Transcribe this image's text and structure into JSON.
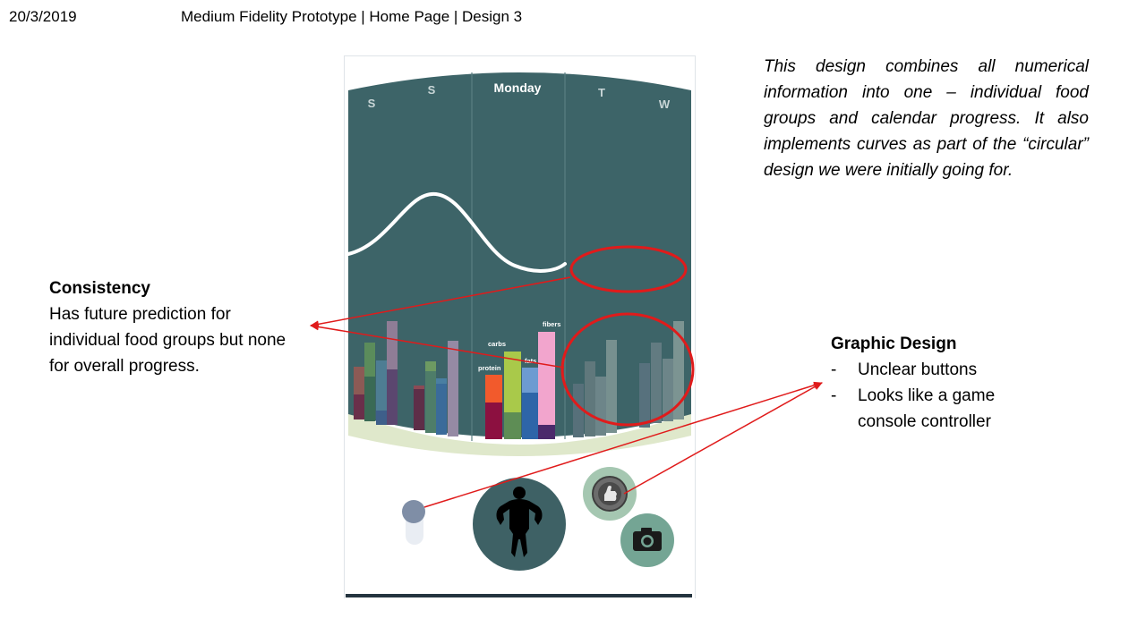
{
  "header": {
    "date": "20/3/2019",
    "title": "Medium Fidelity Prototype | Home Page | Design 3"
  },
  "phone": {
    "days": [
      "S",
      "S",
      "Monday",
      "T",
      "W"
    ],
    "bar_labels": {
      "protein": "protein",
      "carbs": "carbs",
      "fats": "fats",
      "fibers": "fibers"
    },
    "buttons": [
      "toggle",
      "body-profile",
      "achievements",
      "camera"
    ]
  },
  "description": "This design combines all numerical information into one – individual food groups and calendar progress. It also implements curves as part of the “circular” design we were initially going for.",
  "consistency": {
    "heading": "Consistency",
    "body": "Has future prediction for individual food groups but none for overall progress."
  },
  "graphic_design": {
    "heading": "Graphic Design",
    "items": [
      "Unclear buttons",
      "Looks like a game console controller"
    ]
  },
  "colors": {
    "panel": "#3d6468",
    "divider": "#5a7f82",
    "arc": "#dfe8cb",
    "annotation": "#e01b1b",
    "button_dark": "#3e6165",
    "button_light": "#a5c7b1",
    "button_mid": "#74a594",
    "toggle_knob": "#7f8ea6",
    "toggle_track": "#e9edf3"
  }
}
